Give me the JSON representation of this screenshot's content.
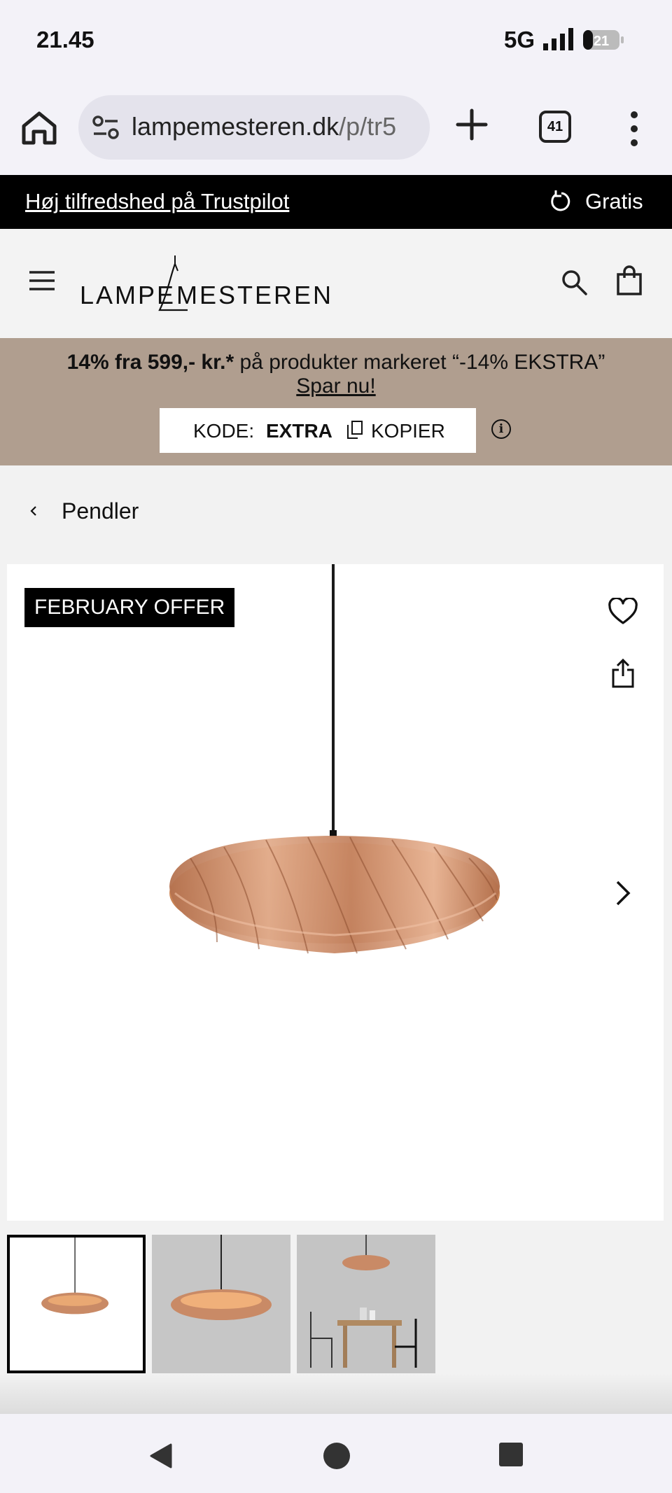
{
  "status_bar": {
    "time": "21.45",
    "network": "5G",
    "battery": "21"
  },
  "browser": {
    "url_domain": "lampemesteren.dk",
    "url_path": "/p/tr5",
    "tab_count": "41"
  },
  "announcement": {
    "trustpilot": "Høj tilfredshed på Trustpilot",
    "gratis": "Gratis"
  },
  "header": {
    "logo_left": "LAMPE",
    "logo_right": "MESTEREN"
  },
  "promo": {
    "bold_text": "14% fra 599,- kr.*",
    "text": " på produkter markeret “-14% EKSTRA”",
    "cta": "Spar nu!",
    "code_label": "KODE:",
    "code_value": "EXTRA",
    "copy_label": "KOPIER",
    "info_icon": "i"
  },
  "breadcrumb": {
    "label": "Pendler"
  },
  "product": {
    "badge": "FEBRUARY OFFER",
    "thumbnails": [
      "thumb-product-white",
      "thumb-product-grey",
      "thumb-room-scene"
    ],
    "active_thumbnail": 0
  },
  "colors": {
    "announce_bg": "#000000",
    "promo_bg": "#b09e8f",
    "copper": "#c98a66"
  }
}
